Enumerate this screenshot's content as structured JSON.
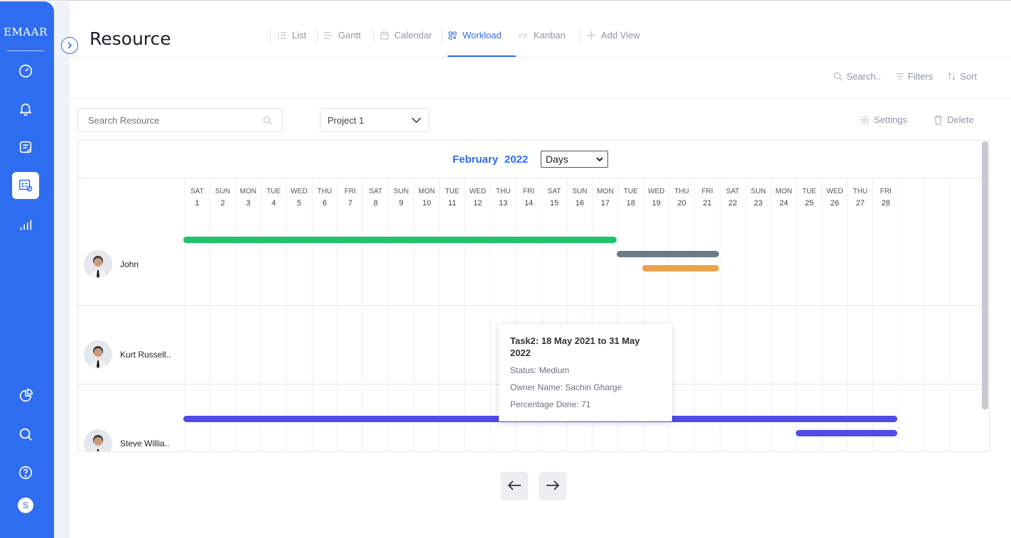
{
  "brand": "EMAAR",
  "sidebar": {
    "items": [
      {
        "icon": "dashboard-gauge-icon"
      },
      {
        "icon": "bell-icon"
      },
      {
        "icon": "note-icon"
      },
      {
        "icon": "resource-schedule-icon",
        "active": true
      },
      {
        "icon": "bar-chart-icon"
      }
    ],
    "bottom": [
      {
        "icon": "pie-chart-icon"
      },
      {
        "icon": "search-icon"
      },
      {
        "icon": "help-icon"
      }
    ],
    "avatar_initial": "S"
  },
  "header": {
    "title": "Resource",
    "tabs": [
      {
        "label": "List",
        "icon": "list-icon"
      },
      {
        "label": "Gantt",
        "icon": "gantt-icon"
      },
      {
        "label": "Calendar",
        "icon": "calendar-icon"
      },
      {
        "label": "Workload",
        "icon": "workload-icon",
        "active": true
      },
      {
        "label": "Kanban",
        "icon": "kanban-icon"
      },
      {
        "label": "Add View",
        "icon": "plus-icon"
      }
    ]
  },
  "toolbar": {
    "search": "Search..",
    "filters": "Filters",
    "sort": "Sort"
  },
  "controls": {
    "search_placeholder": "Search Resource",
    "project": "Project 1",
    "settings": "Settings",
    "delete": "Delete"
  },
  "calendar": {
    "month": "February",
    "year": "2022",
    "view": "Days",
    "days": [
      {
        "dow": "SAT",
        "d": "1"
      },
      {
        "dow": "SUN",
        "d": "2"
      },
      {
        "dow": "MON",
        "d": "3"
      },
      {
        "dow": "TUE",
        "d": "4"
      },
      {
        "dow": "WED",
        "d": "5"
      },
      {
        "dow": "THU",
        "d": "6"
      },
      {
        "dow": "FRI",
        "d": "7"
      },
      {
        "dow": "SAT",
        "d": "8"
      },
      {
        "dow": "SUN",
        "d": "9"
      },
      {
        "dow": "MON",
        "d": "10"
      },
      {
        "dow": "TUE",
        "d": "11"
      },
      {
        "dow": "WED",
        "d": "12"
      },
      {
        "dow": "THU",
        "d": "13"
      },
      {
        "dow": "FRI",
        "d": "14"
      },
      {
        "dow": "SAT",
        "d": "15"
      },
      {
        "dow": "SUN",
        "d": "16"
      },
      {
        "dow": "MON",
        "d": "17"
      },
      {
        "dow": "TUE",
        "d": "18"
      },
      {
        "dow": "WED",
        "d": "19"
      },
      {
        "dow": "THU",
        "d": "20"
      },
      {
        "dow": "FRI",
        "d": "21"
      },
      {
        "dow": "SAT",
        "d": "22"
      },
      {
        "dow": "SUN",
        "d": "23"
      },
      {
        "dow": "MON",
        "d": "24"
      },
      {
        "dow": "TUE",
        "d": "25"
      },
      {
        "dow": "WED",
        "d": "26"
      },
      {
        "dow": "THU",
        "d": "27"
      },
      {
        "dow": "FRI",
        "d": "28"
      },
      {
        "dow": "",
        "d": ""
      },
      {
        "dow": "",
        "d": ""
      },
      {
        "dow": "",
        "d": ""
      }
    ]
  },
  "resources": [
    {
      "name": "John",
      "bars": [
        {
          "start": 1,
          "end": 17,
          "color": "#1fc46b"
        },
        {
          "start": 18,
          "end": 21,
          "color": "#6c7a86"
        },
        {
          "start": 19,
          "end": 21,
          "color": "#e9a24b"
        }
      ]
    },
    {
      "name": "Kurt Russell..",
      "bars": []
    },
    {
      "name": "Steve Willia..",
      "bars": [
        {
          "start": 1,
          "end": 28,
          "color": "#4f4ce8"
        },
        {
          "start": 25,
          "end": 28,
          "color": "#4f4ce8"
        }
      ]
    }
  ],
  "tooltip": {
    "title": "Task2: 18 May 2021 to 31 May 2022",
    "status": "Status: Medium",
    "owner": "Owner Name: Sachin Gharge",
    "percentage": "Percentage Done: 71"
  }
}
